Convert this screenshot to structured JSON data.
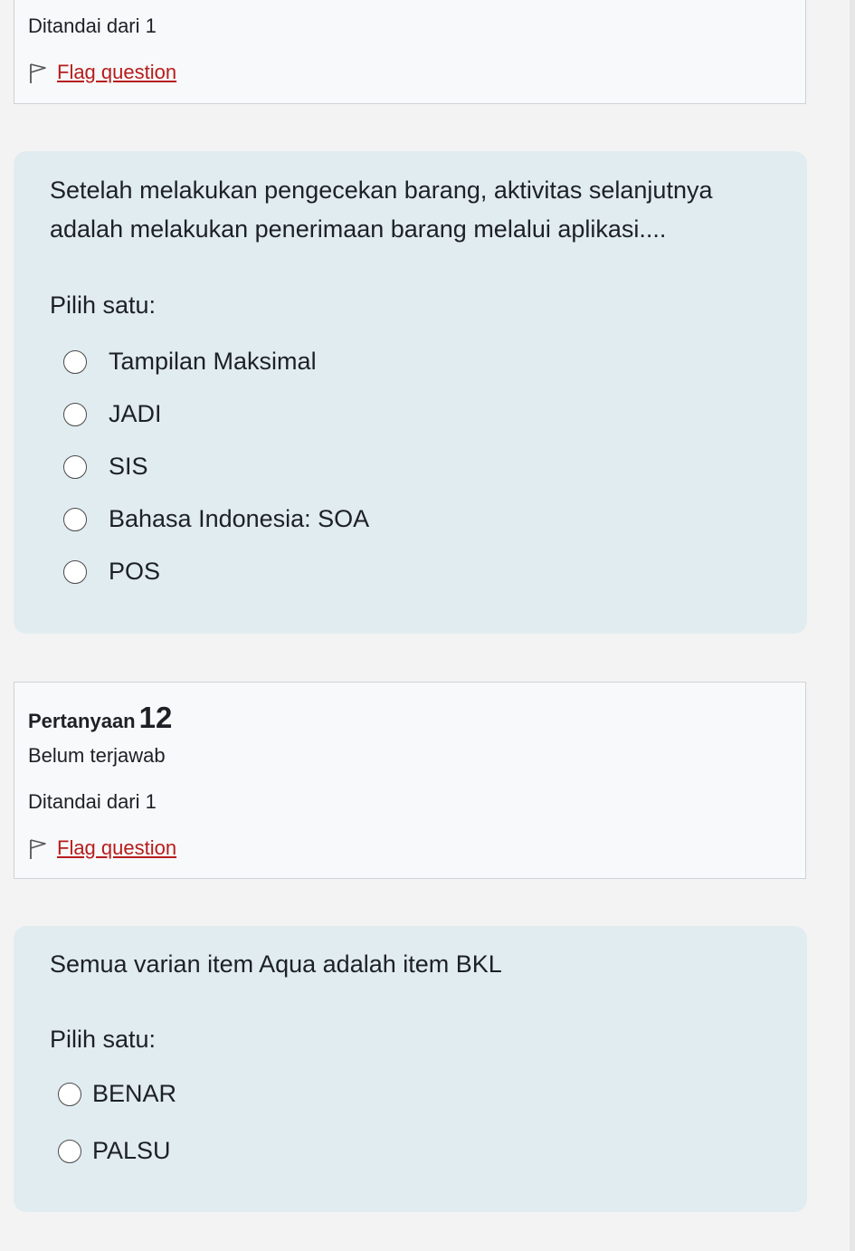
{
  "question11_info": {
    "marked": "Ditandai dari 1",
    "flag_label": "Flag question"
  },
  "question11": {
    "text": "Setelah melakukan pengecekan barang, aktivitas selanjutnya adalah melakukan penerimaan barang melalui aplikasi....",
    "prompt": "Pilih satu:",
    "options": [
      {
        "label": "Tampilan Maksimal",
        "selected": false
      },
      {
        "label": "JADI",
        "selected": false
      },
      {
        "label": "SIS",
        "selected": false
      },
      {
        "label": "Bahasa Indonesia: SOA",
        "selected": false
      },
      {
        "label": "POS",
        "selected": false
      }
    ]
  },
  "question12_info": {
    "heading": "Pertanyaan",
    "number": "12",
    "status": "Belum terjawab",
    "marked": "Ditandai dari 1",
    "flag_label": "Flag question"
  },
  "question12": {
    "text": "Semua varian item Aqua adalah item BKL",
    "prompt": "Pilih satu:",
    "options": [
      {
        "label": "BENAR",
        "selected": false
      },
      {
        "label": "PALSU",
        "selected": false
      }
    ]
  },
  "colors": {
    "card_background": "#e1ecf0",
    "info_background": "#f8f9fa",
    "flag_link": "#b71c1c"
  }
}
